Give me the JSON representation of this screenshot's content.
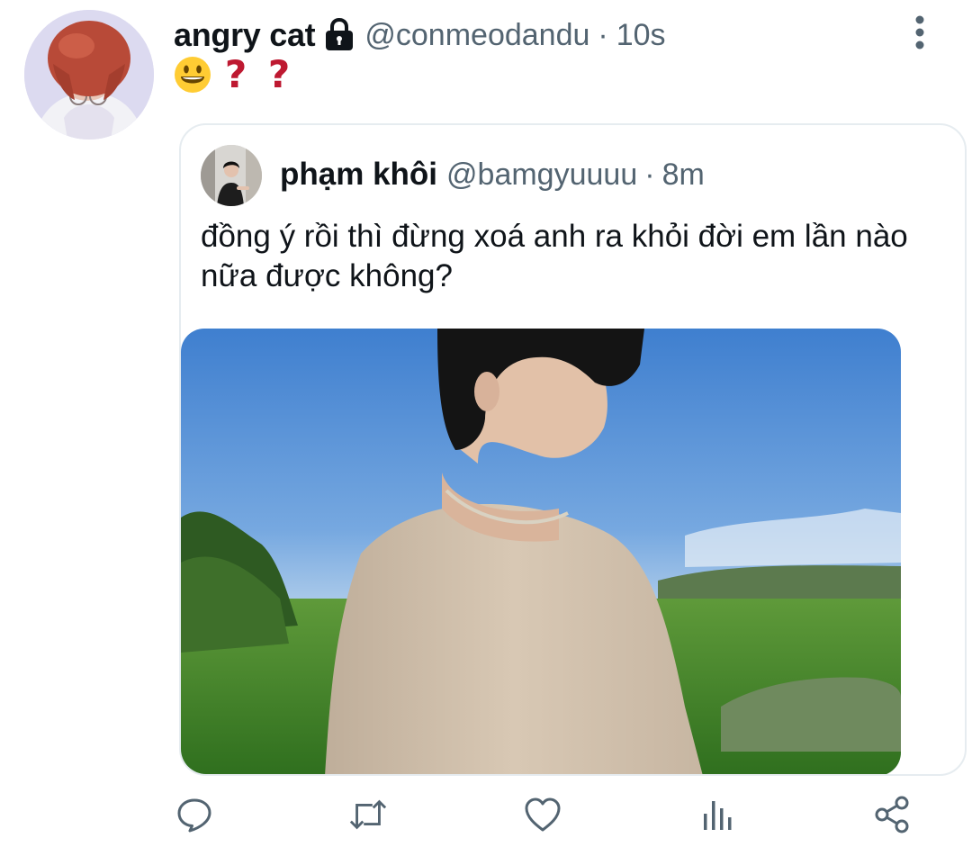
{
  "tweet": {
    "display_name": "angry cat",
    "handle": "@conmeodandu",
    "separator": "·",
    "time": "10s",
    "content": {
      "emoji": "grinning-face",
      "question_marks": [
        "?",
        "?"
      ]
    }
  },
  "quoted_tweet": {
    "display_name": "phạm khôi",
    "handle": "@bamgyuuuu",
    "separator": "·",
    "time": "8m",
    "text": "đồng ý rồi thì đừng xoá anh ra khỏi đời em lần nào nữa được không?"
  },
  "actions": [
    {
      "icon": "reply-icon"
    },
    {
      "icon": "retweet-icon"
    },
    {
      "icon": "like-icon"
    },
    {
      "icon": "analytics-icon"
    },
    {
      "icon": "share-icon"
    }
  ],
  "colors": {
    "text_primary": "#0f1419",
    "text_secondary": "#536471",
    "icon_gray": "#536471",
    "border": "#e6ecf0",
    "question_mark": "#be1931"
  }
}
